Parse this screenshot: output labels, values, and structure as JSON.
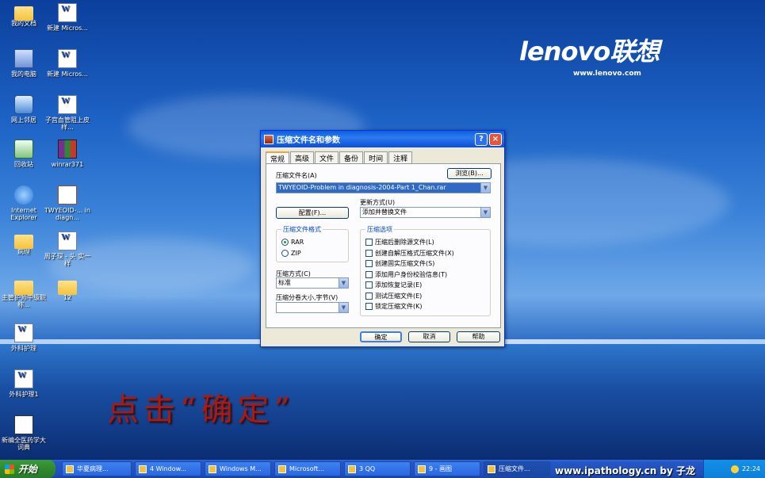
{
  "desktop_icons": [
    {
      "label": "我的文档",
      "type": "folder"
    },
    {
      "label": "新建 Micros...",
      "type": "doc"
    },
    {
      "label": "我的电脑",
      "type": "computer"
    },
    {
      "label": "新建 Micros...",
      "type": "doc"
    },
    {
      "label": "网上邻居",
      "type": "network"
    },
    {
      "label": "子宫血管阻上皮样...",
      "type": "doc"
    },
    {
      "label": "回收站",
      "type": "recycle"
    },
    {
      "label": "winrar371",
      "type": "rar"
    },
    {
      "label": "Internet Explorer",
      "type": "ie"
    },
    {
      "label": "TWYEOID-... in diagn...",
      "type": "ppt"
    },
    {
      "label": "病理",
      "type": "folder"
    },
    {
      "label": "周子琛 - 头 实一样",
      "type": "doc"
    },
    {
      "label": "主管护师中级职称...",
      "type": "folder"
    },
    {
      "label": "12",
      "type": "folder"
    },
    {
      "label": "外科护理",
      "type": "doc"
    },
    {
      "label": "外科护理1",
      "type": "doc"
    },
    {
      "label": "新编全医药学大词典",
      "type": "app"
    }
  ],
  "brand": {
    "logo": "lenovo联想",
    "url": "www.lenovo.com"
  },
  "caption": "点击“确定”",
  "dialog": {
    "title": "压缩文件名和参数",
    "help": "?",
    "close": "×",
    "tabs": [
      "常规",
      "高级",
      "文件",
      "备份",
      "时间",
      "注释"
    ],
    "archive_name_label": "压缩文件名(A)",
    "browse": "浏览(B)...",
    "archive_name_value": "TWYEOID-Problem in diagnosis-2004-Part 1_Chan.rar",
    "config": "配置(F)...",
    "update_label": "更新方式(U)",
    "update_value": "添加并替换文件",
    "format_group": "压缩文件格式",
    "format_rar": "RAR",
    "format_zip": "ZIP",
    "options_group": "压缩选项",
    "options": [
      "压缩后删除源文件(L)",
      "创建自解压格式压缩文件(X)",
      "创建固实压缩文件(S)",
      "添加用户身份校验信息(T)",
      "添加恢复记录(E)",
      "测试压缩文件(E)",
      "锁定压缩文件(K)"
    ],
    "method_label": "压缩方式(C)",
    "method_value": "标准",
    "split_label": "压缩分卷大小,字节(V)",
    "split_value": "",
    "ok": "确定",
    "cancel": "取消",
    "help_btn": "帮助"
  },
  "taskbar": {
    "start": "开始",
    "items": [
      "华夏病理...",
      "4 Window...",
      "Windows M...",
      "Microsoft...",
      "3 QQ",
      "9 - 画图",
      "压缩文件..."
    ],
    "watermark": "www.ipathology.cn by 子龙",
    "time": "22:24"
  }
}
